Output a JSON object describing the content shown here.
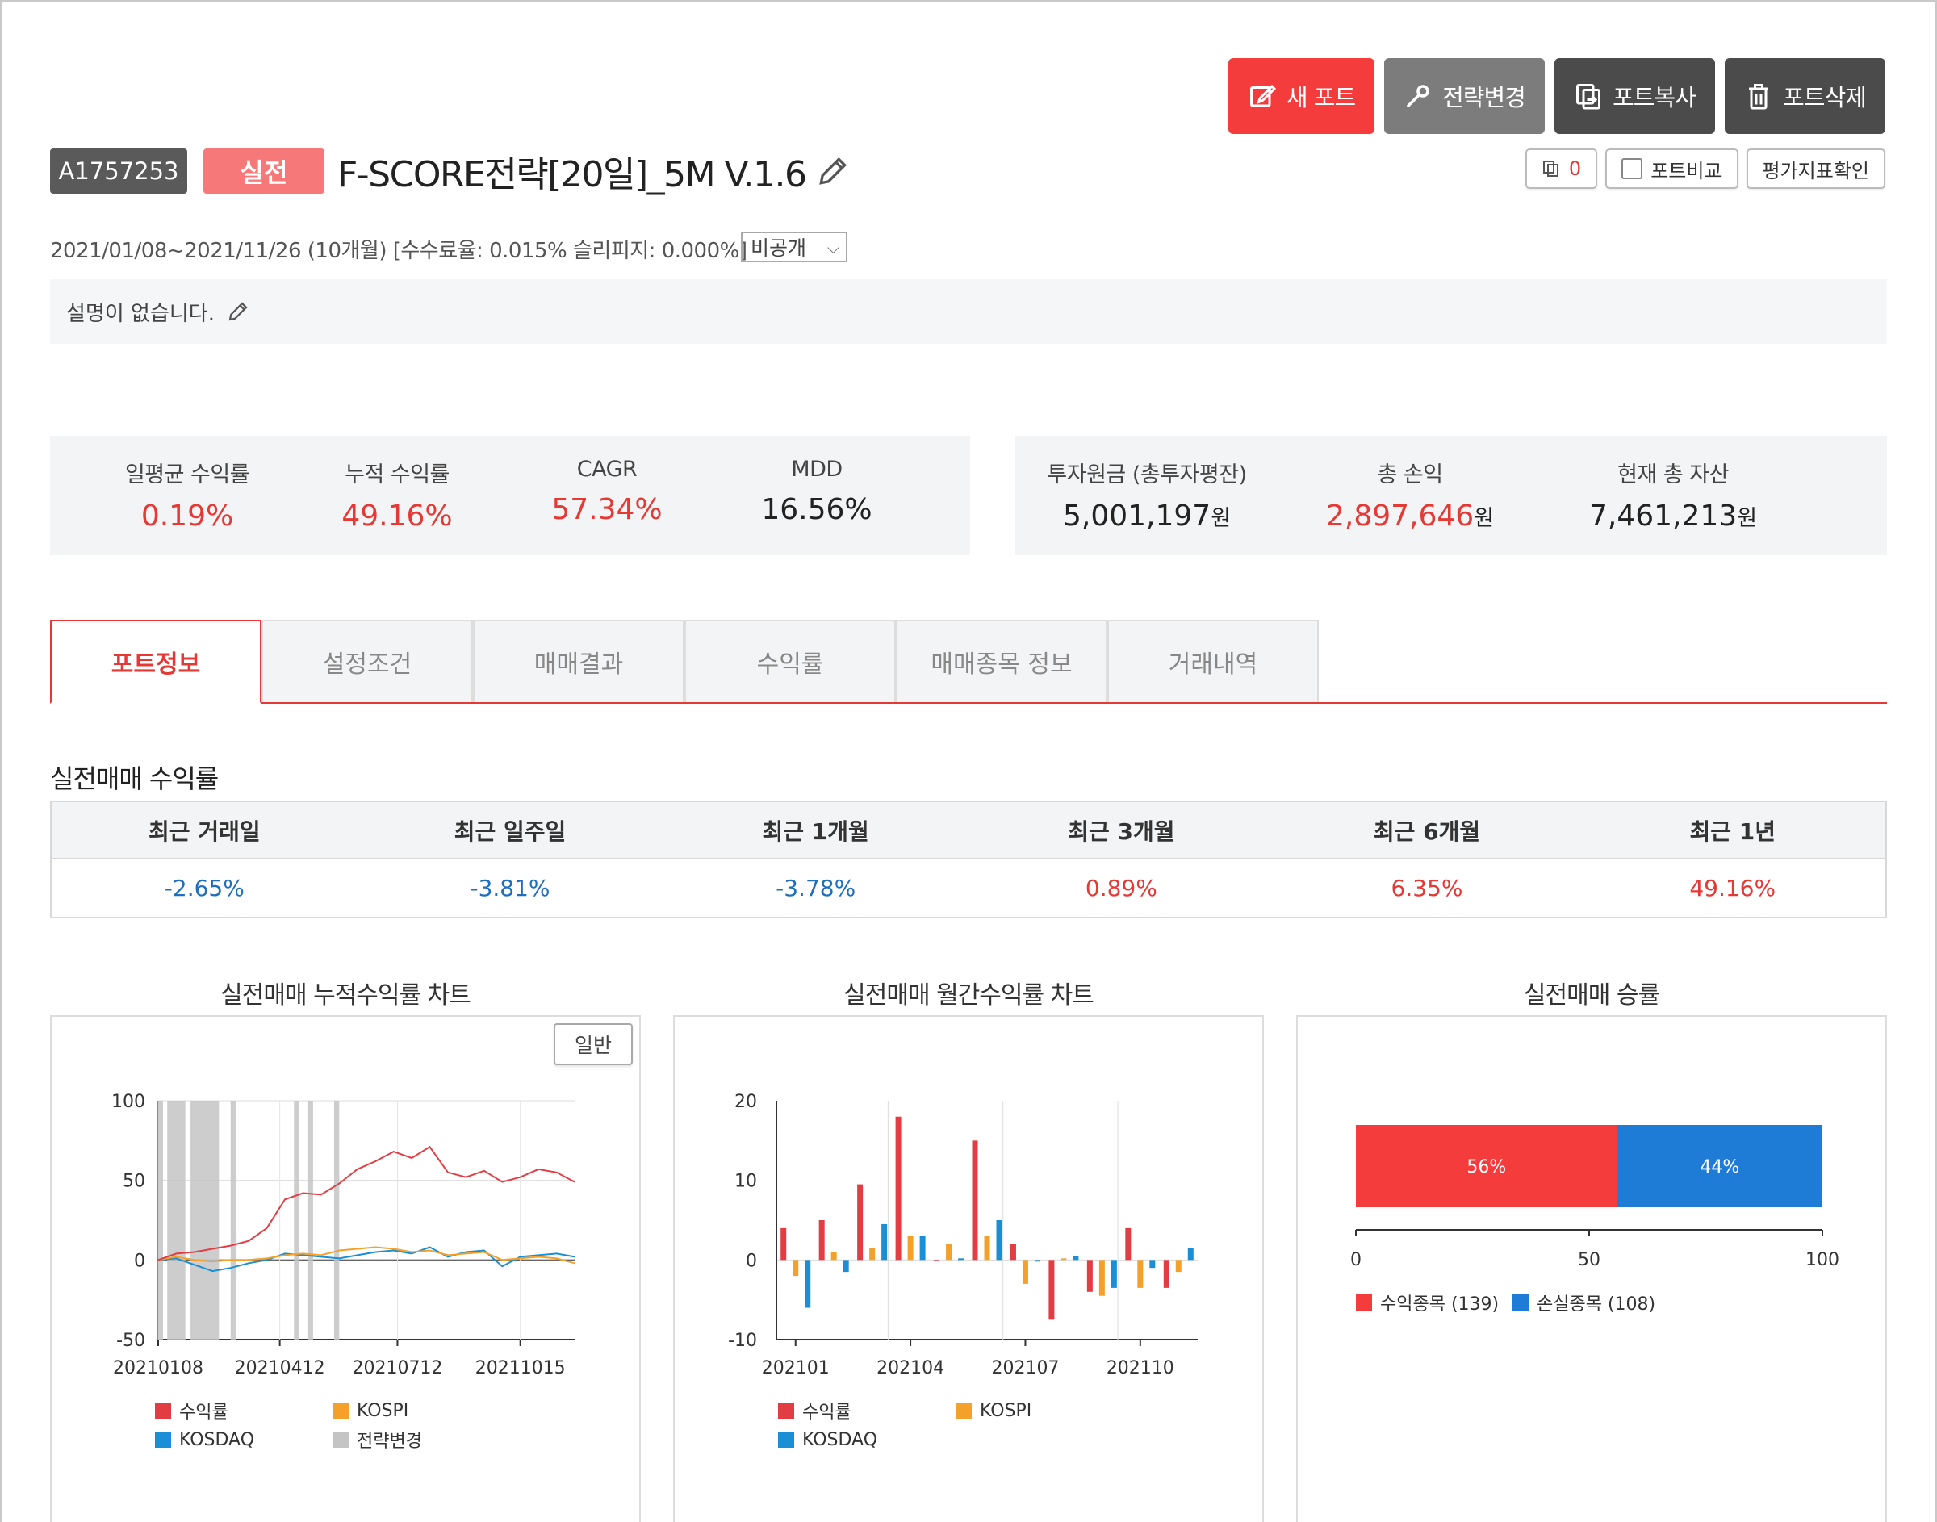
{
  "actions": {
    "new_port": "새 포트",
    "change_strategy": "전략변경",
    "copy_port": "포트복사",
    "delete_port": "포트삭제"
  },
  "subactions": {
    "copy_count": "0",
    "compare": "포트비교",
    "evaluate": "평가지표확인"
  },
  "portfolio": {
    "id": "A1757253",
    "status": "실전",
    "name": "F-SCORE전략[20일]_5M V.1.6",
    "meta": "2021/01/08~2021/11/26 (10개월) [수수료율: 0.015% 슬리피지: 0.000%]",
    "visibility": "비공개",
    "description": "설명이 없습니다."
  },
  "stats_left": [
    {
      "label": "일평균 수익률",
      "value": "0.19%"
    },
    {
      "label": "누적 수익률",
      "value": "49.16%"
    },
    {
      "label": "CAGR",
      "value": "57.34%"
    },
    {
      "label": "MDD",
      "value": "16.56%"
    }
  ],
  "stats_right": [
    {
      "label": "투자원금 (총투자평잔)",
      "value": "5,001,197",
      "unit": "원"
    },
    {
      "label": "총 손익",
      "value": "2,897,646",
      "unit": "원"
    },
    {
      "label": "현재 총 자산",
      "value": "7,461,213",
      "unit": "원"
    }
  ],
  "tabs": [
    "포트정보",
    "설정조건",
    "매매결과",
    "수익률",
    "매매종목 정보",
    "거래내역"
  ],
  "live_returns": {
    "title": "실전매매 수익률",
    "headers": [
      "최근 거래일",
      "최근 일주일",
      "최근 1개월",
      "최근 3개월",
      "최근 6개월",
      "최근 1년"
    ],
    "values": [
      "-2.65%",
      "-3.81%",
      "-3.78%",
      "0.89%",
      "6.35%",
      "49.16%"
    ]
  },
  "colors": {
    "accent": "#f53c3c",
    "red_series": "#e33d44",
    "orange_series": "#f4a12c",
    "blue_series": "#1a8fd6",
    "grey_series": "#c4c4c4",
    "win": "#f53c3c",
    "loss": "#1e7bd6"
  },
  "charts": {
    "cumulative": {
      "title": "실전매매 누적수익률 차트",
      "mode_button": "일반"
    },
    "monthly": {
      "title": "실전매매 월간수익률 차트"
    },
    "winrate": {
      "title": "실전매매 승률"
    }
  },
  "chart_data": [
    {
      "type": "line",
      "title": "실전매매 누적수익률 차트",
      "ylim": [
        -50,
        100
      ],
      "y_ticks": [
        100,
        50,
        0,
        -50
      ],
      "x_tick_labels": [
        "20210108",
        "20210412",
        "20210712",
        "20211015"
      ],
      "x_range": [
        "2021-01-08",
        "2021-11-26"
      ],
      "x": [
        "2021-01-08",
        "2021-01-22",
        "2021-02-05",
        "2021-02-19",
        "2021-03-05",
        "2021-03-19",
        "2021-04-02",
        "2021-04-16",
        "2021-04-30",
        "2021-05-14",
        "2021-05-28",
        "2021-06-11",
        "2021-06-25",
        "2021-07-09",
        "2021-07-23",
        "2021-08-06",
        "2021-08-20",
        "2021-09-03",
        "2021-09-17",
        "2021-10-01",
        "2021-10-15",
        "2021-10-29",
        "2021-11-12",
        "2021-11-26"
      ],
      "series": [
        {
          "name": "수익률",
          "values": [
            0,
            4,
            5,
            7,
            9,
            12,
            20,
            38,
            42,
            41,
            48,
            57,
            62,
            68,
            64,
            71,
            55,
            52,
            56,
            49,
            52,
            57,
            55,
            49
          ]
        },
        {
          "name": "KOSPI",
          "values": [
            0,
            2,
            0,
            -1,
            0,
            0,
            1,
            3,
            4,
            3,
            6,
            7,
            8,
            7,
            5,
            6,
            3,
            4,
            5,
            0,
            1,
            2,
            1,
            -2
          ]
        },
        {
          "name": "KOSDAQ",
          "values": [
            0,
            1,
            -3,
            -7,
            -5,
            -2,
            0,
            4,
            3,
            2,
            1,
            3,
            5,
            6,
            4,
            8,
            2,
            5,
            6,
            -4,
            2,
            3,
            4,
            2
          ]
        }
      ],
      "strategy_change_periods": [
        [
          "2021-01-08",
          "2021-01-11"
        ],
        [
          "2021-01-15",
          "2021-01-29"
        ],
        [
          "2021-02-02",
          "2021-02-24"
        ],
        [
          "2021-03-05",
          "2021-03-09"
        ],
        [
          "2021-04-23",
          "2021-04-27"
        ],
        [
          "2021-05-04",
          "2021-05-07"
        ],
        [
          "2021-05-24",
          "2021-05-28"
        ]
      ],
      "legend": [
        "수익률",
        "KOSPI",
        "KOSDAQ",
        "전략변경"
      ]
    },
    {
      "type": "bar",
      "title": "실전매매 월간수익률 차트",
      "ylim": [
        -10,
        20
      ],
      "y_ticks": [
        20,
        10,
        0,
        -10
      ],
      "categories": [
        "202101",
        "202102",
        "202103",
        "202104",
        "202105",
        "202106",
        "202107",
        "202108",
        "202109",
        "202110",
        "202111"
      ],
      "x_tick_labels": [
        "202101",
        "202104",
        "202107",
        "202110"
      ],
      "series": [
        {
          "name": "수익률",
          "values": [
            4,
            5,
            9.5,
            18,
            0,
            15,
            2,
            -7.5,
            -4,
            4,
            -3.5
          ]
        },
        {
          "name": "KOSPI",
          "values": [
            -2,
            1,
            1.5,
            3,
            2,
            3,
            -3,
            0.2,
            -4.5,
            -3.5,
            -1.5
          ]
        },
        {
          "name": "KOSDAQ",
          "values": [
            -6,
            -1.5,
            4.5,
            3,
            0.2,
            5,
            -0.2,
            0.5,
            -3.5,
            -1,
            1.5
          ]
        }
      ],
      "legend": [
        "수익률",
        "KOSPI",
        "KOSDAQ"
      ]
    },
    {
      "type": "bar",
      "title": "실전매매 승률",
      "orientation": "horizontal-stacked",
      "xlim": [
        0,
        100
      ],
      "x_ticks": [
        0,
        50,
        100
      ],
      "series": [
        {
          "name": "수익종목 (139)",
          "values": [
            56
          ],
          "label": "56%"
        },
        {
          "name": "손실종목 (108)",
          "values": [
            44
          ],
          "label": "44%"
        }
      ],
      "legend": [
        "수익종목 (139)",
        "손실종목 (108)"
      ]
    }
  ]
}
